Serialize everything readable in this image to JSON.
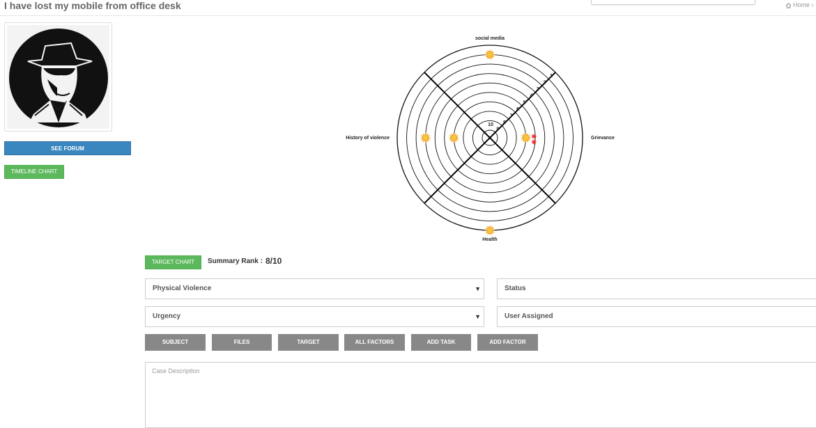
{
  "header": {
    "title": "I have lost my mobile from office desk",
    "breadcrumb": "Home",
    "search_placeholder": ""
  },
  "sidebar": {
    "avatar_icon": "detective-silhouette-icon",
    "see_forum_label": "SEE FORUM",
    "timeline_label": "TIMELINE CHART"
  },
  "target": {
    "button_label": "TARGET CHART",
    "summary_label": "Summary Rank :",
    "summary_value": "8/10"
  },
  "chart_data": {
    "type": "radar-target",
    "axes": [
      "social media",
      "Grievance",
      "Health",
      "History of violence"
    ],
    "ring_labels": [
      "1",
      "2",
      "3",
      "4",
      "5",
      "6",
      "7",
      "8",
      "9",
      "10"
    ],
    "markers": [
      {
        "axis": "social media",
        "rank": 2,
        "icon": "sun-icon"
      },
      {
        "axis": "Grievance",
        "rank": 7,
        "icon": "sun-icon"
      },
      {
        "axis": "Grievance",
        "rank": 6,
        "icon": "virus-icon",
        "color": "#e22"
      },
      {
        "axis": "Health",
        "rank": 1,
        "icon": "sun-icon"
      },
      {
        "axis": "History of violence",
        "rank": 7,
        "icon": "sun-icon"
      },
      {
        "axis": "History of violence",
        "rank": 4,
        "icon": "sun-icon"
      }
    ],
    "colors": {
      "marker": "#f5a623",
      "alert": "#e22"
    }
  },
  "form": {
    "category": "Physical Violence",
    "urgency": "Urgency",
    "status": "Status",
    "user_assigned": "User Assigned"
  },
  "actions": [
    "SUBJECT",
    "FILES",
    "TARGET",
    "ALL FACTORS",
    "ADD TASK",
    "ADD FACTOR"
  ],
  "case_description_placeholder": "Case Description"
}
